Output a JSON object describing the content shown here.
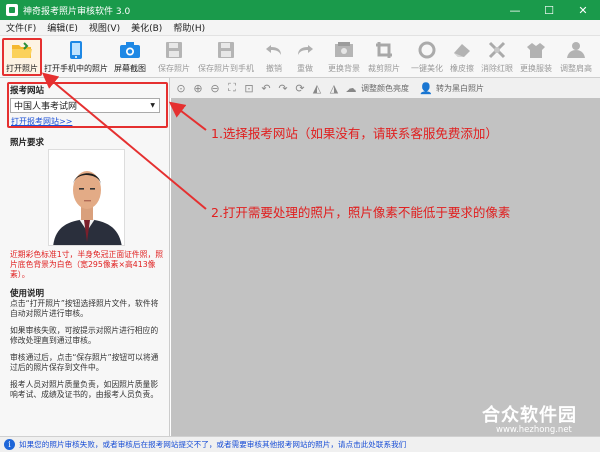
{
  "window": {
    "title": "神奇报考照片审核软件 3.0",
    "controls": {
      "minimize": "—",
      "maximize": "☐",
      "close": "✕"
    }
  },
  "menu": [
    "文件(F)",
    "编辑(E)",
    "视图(V)",
    "美化(B)",
    "帮助(H)"
  ],
  "toolbar": {
    "open_photo": "打开照片",
    "open_phone_photo": "打开手机中的照片",
    "screenshot": "屏幕截图",
    "save_photo": "保存照片",
    "save_to_phone": "保存照片到手机",
    "undo": "撤销",
    "redo": "重做",
    "replace_bg": "更换背景",
    "crop": "裁剪照片",
    "beautify": "一键美化",
    "eraser": "橡皮擦",
    "red_eye": "消除红眼",
    "replace_clothes": "更换服装",
    "adjust_head": "调整肩高"
  },
  "subtoolbar": {
    "adjust_color": "调整颜色亮度",
    "to_grayscale": "转为黑白照片"
  },
  "left_panel": {
    "site_title": "报考网站",
    "site_selected": "中国人事考试网",
    "open_site_link": "打开报考网站>>",
    "photo_req_title": "照片要求",
    "photo_req_note": "近期彩色标准1寸，半身免冠正面证件照，照片底色背景为白色（宽295像素×高413像素）。",
    "usage_title": "使用说明",
    "usage_paragraphs": [
      "点击“打开照片”按钮选择照片文件，软件将自动对照片进行审核。",
      "如果审核失败，可按提示对照片进行相应的修改处理直到通过审核。",
      "审核通过后，点击“保存照片”按钮可以将通过后的照片保存到文件中。",
      "报考人员对照片质量负责，如因照片质量影响考试、成绩及证书的，由报考人员负责。"
    ]
  },
  "annotations": {
    "step1": "1.选择报考网站（如果没有，请联系客服免费添加）",
    "step2": "2.打开需要处理的照片，照片像素不能低于要求的像素"
  },
  "status": "如果您的照片审核失败，或者审核后在报考网站提交不了，或者需要审核其他报考网站的照片，请点击此处联系我们",
  "watermark": {
    "name": "合众软件园",
    "url": "www.hezhong.net"
  },
  "colors": {
    "titlebar": "#1a9a4b",
    "highlight": "#e53030",
    "link": "#1a4fd6",
    "workarea": "#c2c2c2"
  }
}
